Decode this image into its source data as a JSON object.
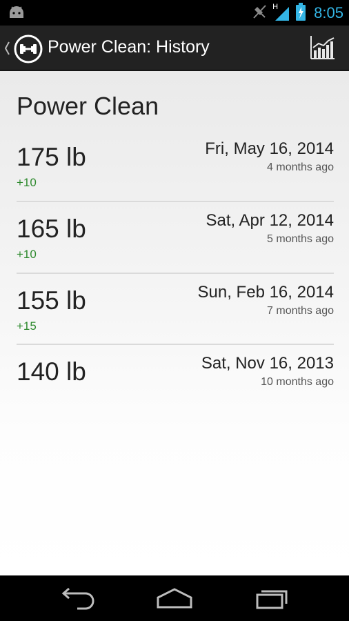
{
  "status_bar": {
    "time": "8:05",
    "network_label": "H",
    "icons": [
      "android-notification-icon",
      "no-sync-icon",
      "signal-icon",
      "battery-charging-icon"
    ],
    "accent_color": "#33b5e5"
  },
  "action_bar": {
    "title": "Power Clean: History",
    "app_icon": "dumbbell-icon",
    "action_icon": "chart-icon"
  },
  "page": {
    "title": "Power Clean"
  },
  "history": [
    {
      "weight": "175 lb",
      "delta": "+10",
      "date": "Fri, May 16, 2014",
      "ago": "4 months ago"
    },
    {
      "weight": "165 lb",
      "delta": "+10",
      "date": "Sat, Apr 12, 2014",
      "ago": "5 months ago"
    },
    {
      "weight": "155 lb",
      "delta": "+15",
      "date": "Sun, Feb 16, 2014",
      "ago": "7 months ago"
    },
    {
      "weight": "140 lb",
      "delta": "",
      "date": "Sat, Nov 16, 2013",
      "ago": "10 months ago"
    }
  ],
  "colors": {
    "delta_positive": "#2e8a2e"
  },
  "nav_bar": {
    "icons": [
      "back-icon",
      "home-icon",
      "recent-apps-icon"
    ]
  }
}
